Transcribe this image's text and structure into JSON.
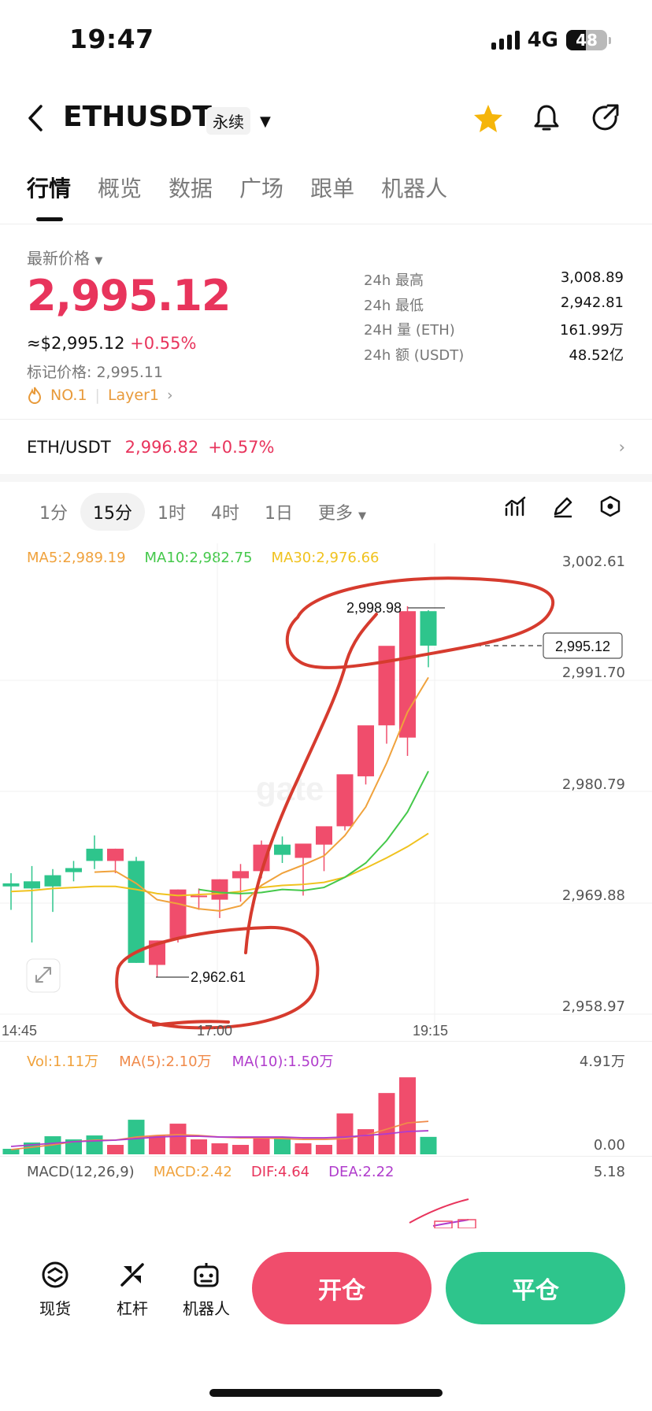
{
  "status": {
    "time": "19:47",
    "network": "4G",
    "battery": "48"
  },
  "header": {
    "pair": "ETHUSDT",
    "contract_type": "永续"
  },
  "tabs": [
    "行情",
    "概览",
    "数据",
    "广场",
    "跟单",
    "机器人"
  ],
  "ticker": {
    "latest_label": "最新价格",
    "price": "2,995.12",
    "usd_value": "≈$2,995.12",
    "change": "+0.55%",
    "mark_price": "标记价格: 2,995.11",
    "rank_tag": "NO.1",
    "category_tag": "Layer1",
    "stats": [
      {
        "label": "24h  最高",
        "value": "3,008.89"
      },
      {
        "label": "24h  最低",
        "value": "2,942.81"
      },
      {
        "label": "24H  量 (ETH)",
        "value": "161.99万"
      },
      {
        "label": "24h  额 (USDT)",
        "value": "48.52亿"
      }
    ]
  },
  "spot": {
    "pair": "ETH/USDT",
    "price": "2,996.82",
    "change": "+0.57%"
  },
  "intervals": {
    "items": [
      "1分",
      "15分",
      "1时",
      "4时",
      "1日"
    ],
    "more": "更多",
    "selected": "15分"
  },
  "chart_data": {
    "type": "candlestick",
    "ma_labels": {
      "ma5": "MA5:2,989.19",
      "ma10": "MA10:2,982.75",
      "ma30": "MA30:2,976.66"
    },
    "y_ticks": [
      "3,002.61",
      "2,991.70",
      "2,980.79",
      "2,969.88",
      "2,958.97"
    ],
    "y_range": [
      2958.97,
      3002.61
    ],
    "x_ticks": [
      "14:45",
      "17:00",
      "19:15"
    ],
    "high_label": "2,998.98",
    "low_label": "2,962.61",
    "last_price_label": "2,995.12",
    "candles": [
      {
        "o": 2971.8,
        "h": 2972.8,
        "l": 2969.2,
        "c": 2971.5
      },
      {
        "o": 2972.0,
        "h": 2973.5,
        "l": 2966.0,
        "c": 2971.3
      },
      {
        "o": 2972.6,
        "h": 2973.2,
        "l": 2969.0,
        "c": 2971.5
      },
      {
        "o": 2973.3,
        "h": 2974.0,
        "l": 2972.0,
        "c": 2972.9
      },
      {
        "o": 2975.2,
        "h": 2976.5,
        "l": 2973.2,
        "c": 2974.0
      },
      {
        "o": 2974.0,
        "h": 2975.2,
        "l": 2972.8,
        "c": 2975.2
      },
      {
        "o": 2974.0,
        "h": 2974.4,
        "l": 2964.0,
        "c": 2964.0
      },
      {
        "o": 2963.8,
        "h": 2966.2,
        "l": 2962.61,
        "c": 2966.2
      },
      {
        "o": 2966.4,
        "h": 2971.2,
        "l": 2966.0,
        "c": 2971.2
      },
      {
        "o": 2970.6,
        "h": 2971.3,
        "l": 2969.2,
        "c": 2970.6
      },
      {
        "o": 2970.2,
        "h": 2972.2,
        "l": 2968.4,
        "c": 2972.2
      },
      {
        "o": 2972.3,
        "h": 2973.7,
        "l": 2970.0,
        "c": 2973.0
      },
      {
        "o": 2973.0,
        "h": 2976.0,
        "l": 2972.3,
        "c": 2975.6
      },
      {
        "o": 2975.6,
        "h": 2976.4,
        "l": 2973.8,
        "c": 2974.6
      },
      {
        "o": 2974.3,
        "h": 2975.4,
        "l": 2970.6,
        "c": 2975.7
      },
      {
        "o": 2975.6,
        "h": 2976.6,
        "l": 2973.0,
        "c": 2977.4
      },
      {
        "o": 2977.4,
        "h": 2980.6,
        "l": 2977.0,
        "c": 2982.5
      },
      {
        "o": 2982.3,
        "h": 2986.9,
        "l": 2981.5,
        "c": 2987.3
      },
      {
        "o": 2987.3,
        "h": 2991.5,
        "l": 2985.5,
        "c": 2995.1
      },
      {
        "o": 2986.1,
        "h": 2998.98,
        "l": 2984.3,
        "c": 2998.5
      },
      {
        "o": 2998.5,
        "h": 2998.6,
        "l": 2993.0,
        "c": 2995.12
      }
    ],
    "ma5": [
      null,
      null,
      null,
      null,
      2972.9,
      2973.0,
      2971.8,
      2970.2,
      2969.8,
      2969.3,
      2969.1,
      2969.6,
      2971.6,
      2972.8,
      2973.6,
      2974.5,
      2976.5,
      2979.3,
      2983.6,
      2988.6,
      2992.0
    ],
    "ma10": [
      null,
      null,
      null,
      null,
      null,
      null,
      null,
      null,
      null,
      2971.2,
      2970.9,
      2970.8,
      2970.9,
      2971.2,
      2971.1,
      2971.4,
      2972.4,
      2973.8,
      2976.0,
      2978.8,
      2982.8
    ],
    "ma30": [
      2971.0,
      2971.1,
      2971.3,
      2971.4,
      2971.5,
      2971.5,
      2971.2,
      2970.8,
      2970.6,
      2970.7,
      2970.8,
      2971.0,
      2971.4,
      2971.6,
      2971.7,
      2971.9,
      2972.4,
      2973.3,
      2974.3,
      2975.4,
      2976.7
    ]
  },
  "volume": {
    "labels": {
      "vol": "Vol:1.11万",
      "ma5": "MA(5):2.10万",
      "ma10": "MA(10):1.50万"
    },
    "y_top": "4.91万",
    "y_bottom": "0.00",
    "values": [
      0.35,
      0.75,
      1.15,
      0.95,
      1.2,
      0.6,
      2.2,
      1.2,
      1.95,
      0.95,
      0.7,
      0.6,
      1.0,
      1.1,
      0.7,
      0.6,
      2.6,
      1.6,
      3.9,
      4.9,
      1.11
    ],
    "ma5": [
      0.3,
      0.45,
      0.6,
      0.8,
      0.9,
      0.9,
      1.1,
      1.2,
      1.25,
      1.2,
      1.1,
      1.05,
      1.05,
      1.0,
      0.95,
      0.95,
      1.0,
      1.2,
      1.6,
      2.0,
      2.1
    ],
    "ma10": [
      0.5,
      0.6,
      0.7,
      0.8,
      0.85,
      0.9,
      1.0,
      1.1,
      1.15,
      1.15,
      1.1,
      1.1,
      1.1,
      1.1,
      1.05,
      1.05,
      1.1,
      1.2,
      1.3,
      1.45,
      1.5
    ]
  },
  "macd": {
    "labels": {
      "title": "MACD(12,26,9)",
      "macd": "MACD:2.42",
      "dif": "DIF:4.64",
      "dea": "DEA:2.22"
    },
    "y_top": "5.18"
  },
  "bottom_nav": [
    {
      "label": "现货",
      "icon": "spot-icon"
    },
    {
      "label": "杠杆",
      "icon": "leverage-icon"
    },
    {
      "label": "机器人",
      "icon": "robot-icon"
    }
  ],
  "actions": {
    "open": "开仓",
    "close": "平仓"
  },
  "colors": {
    "up": "#f04d6c",
    "down": "#2ec58c",
    "annotation": "#d63b2e"
  }
}
